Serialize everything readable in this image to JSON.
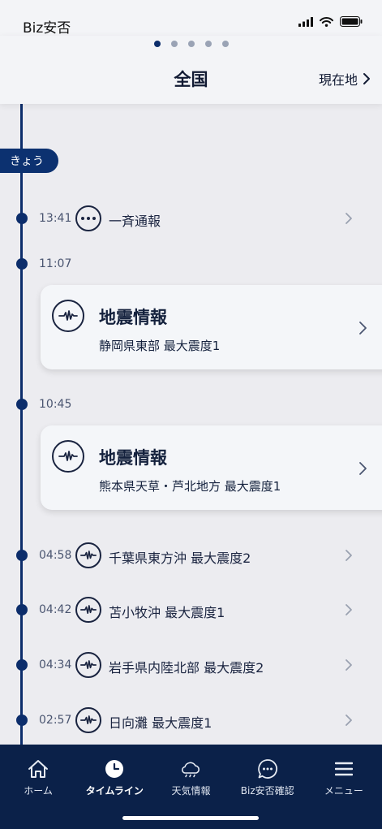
{
  "status_bar": {
    "carrier": "Biz安否",
    "icons": [
      "signal-icon",
      "wifi-icon",
      "battery-icon"
    ]
  },
  "header": {
    "title": "全国",
    "location_link": "現在地",
    "page_count": 5,
    "active_page": 1
  },
  "timeline": {
    "today_label": "きょう",
    "items": [
      {
        "time": "13:41",
        "icon": "more-icon",
        "label": "一斉通報"
      },
      {
        "time": "11:07",
        "card": {
          "icon": "seismic-icon",
          "title": "地震情報",
          "subtitle": "静岡県東部 最大震度1"
        }
      },
      {
        "time": "10:45",
        "card": {
          "icon": "seismic-icon",
          "title": "地震情報",
          "subtitle": "熊本県天草・芦北地方 最大震度1"
        }
      },
      {
        "time": "04:58",
        "icon": "seismic-icon",
        "label": "千葉県東方沖 最大震度2"
      },
      {
        "time": "04:42",
        "icon": "seismic-icon",
        "label": "苫小牧沖 最大震度1"
      },
      {
        "time": "04:34",
        "icon": "seismic-icon",
        "label": "岩手県内陸北部 最大震度2"
      },
      {
        "time": "02:57",
        "icon": "seismic-icon",
        "label": "日向灘 最大震度1"
      }
    ]
  },
  "tab_bar": {
    "tabs": [
      {
        "label": "ホーム",
        "icon": "home-icon"
      },
      {
        "label": "タイムライン",
        "icon": "clock-icon",
        "active": true
      },
      {
        "label": "天気情報",
        "icon": "cloud-icon"
      },
      {
        "label": "Biz安否確認",
        "icon": "chat-icon"
      },
      {
        "label": "メニュー",
        "icon": "menu-icon"
      }
    ]
  },
  "colors": {
    "accent": "#0c2d6b",
    "tab_bar": "#0b2149",
    "background": "#ececf0",
    "card": "#f4f6f9"
  }
}
